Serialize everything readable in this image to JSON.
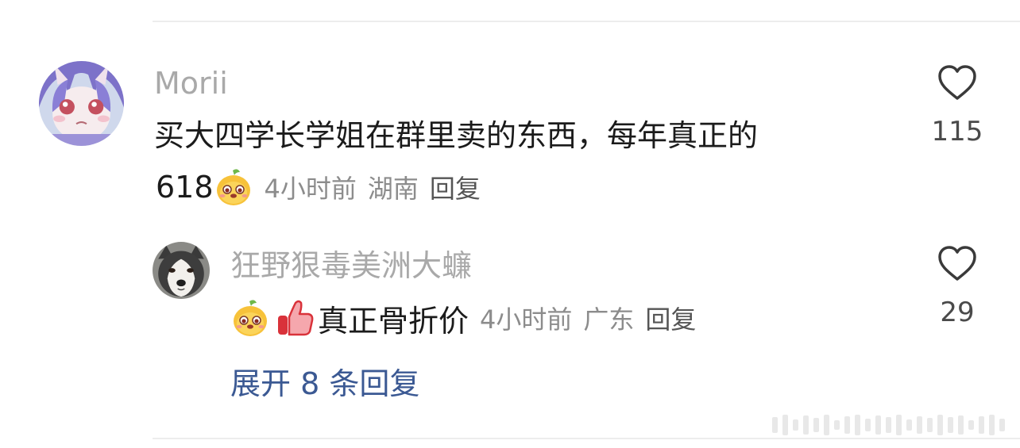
{
  "comment": {
    "username": "Morii",
    "text": "买大四学长学姐在群里卖的东西，每年真正的",
    "text_cont": "618",
    "time": "4小时前",
    "location": "湖南",
    "reply_label": "回复",
    "likes": "115",
    "emoji": "mango-face-emoji",
    "avatar": "anime-girl-avatar"
  },
  "reply": {
    "username": "狂野狠毒美洲大蠊",
    "text": "真正骨折价",
    "time": "4小时前",
    "location": "广东",
    "reply_label": "回复",
    "likes": "29",
    "emojis": [
      "mango-face-emoji",
      "thumbs-up-emoji"
    ],
    "avatar": "husky-dog-avatar"
  },
  "expand_label": "展开 8 条回复",
  "icons": {
    "like": "heart-outline-icon"
  },
  "colors": {
    "username": "#a9a9a9",
    "text": "#1b1b1b",
    "meta": "#8c8c8c",
    "link": "#3b5993",
    "divider": "#ededed"
  }
}
